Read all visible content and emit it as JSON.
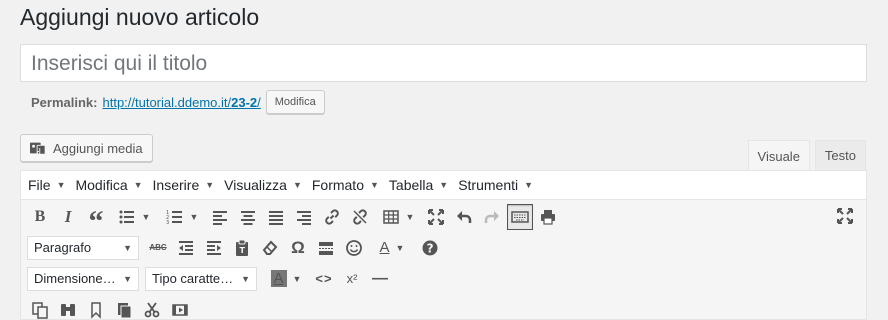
{
  "page": {
    "title": "Aggiungi nuovo articolo"
  },
  "title_field": {
    "placeholder": "Inserisci qui il titolo"
  },
  "permalink": {
    "label": "Permalink:",
    "url_prefix": "http://tutorial.ddemo.it/",
    "url_slug": "23-2",
    "url_suffix": "/",
    "edit_label": "Modifica"
  },
  "media": {
    "add_label": "Aggiungi media"
  },
  "editor_tabs": {
    "visual": "Visuale",
    "text": "Testo"
  },
  "menubar": [
    {
      "label": "File"
    },
    {
      "label": "Modifica"
    },
    {
      "label": "Inserire"
    },
    {
      "label": "Visualizza"
    },
    {
      "label": "Formato"
    },
    {
      "label": "Tabella"
    },
    {
      "label": "Strumenti"
    }
  ],
  "toolbar": {
    "bold": "B",
    "italic": "I",
    "quote": "“",
    "paragraph_select": "Paragrafo",
    "strikethrough": "ABC",
    "omega": "Ω",
    "font_color": "A",
    "help": "?",
    "font_size_select": "Dimensione…",
    "font_family_select": "Tipo caratte…",
    "bg_color": "A",
    "code": "<>",
    "superscript": "x²",
    "hr": "—"
  },
  "colors": {
    "link": "#0073aa",
    "background": "#f1f1f1",
    "toolbar_icon": "#555555"
  }
}
